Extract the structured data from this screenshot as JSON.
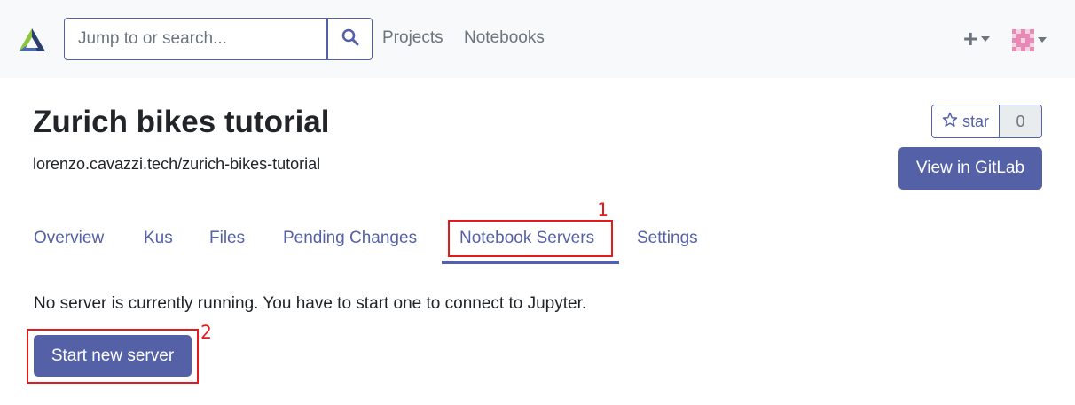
{
  "navbar": {
    "logo_icon": "renku-logo-icon",
    "search": {
      "placeholder": "Jump to or search...",
      "value": "",
      "icon": "search-icon"
    },
    "links": [
      "Projects",
      "Notebooks"
    ],
    "plus_glyph": "+",
    "plus_icon": "plus-icon",
    "avatar_icon": "user-avatar-icon"
  },
  "project": {
    "title": "Zurich bikes tutorial",
    "path": "lorenzo.cavazzi.tech/zurich-bikes-tutorial",
    "star_label": "star",
    "star_count": "0",
    "gitlab_label": "View in GitLab"
  },
  "tabs": {
    "items": [
      "Overview",
      "Kus",
      "Files",
      "Pending Changes",
      "Notebook Servers",
      "Settings"
    ],
    "active": "Notebook Servers"
  },
  "servers": {
    "message": "No server is currently running. You have to start one to connect to Jupyter.",
    "start_label": "Start new server"
  },
  "annotations": {
    "label_1": "1",
    "label_2": "2",
    "color": "#e41a1c"
  },
  "colors": {
    "accent": "#5561a6",
    "navbar_bg": "#f8f9fa",
    "muted": "#6c757d"
  }
}
